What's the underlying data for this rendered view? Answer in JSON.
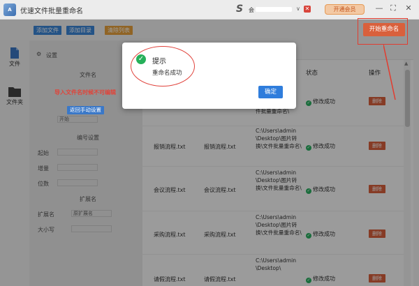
{
  "app": {
    "title": "优速文件批量重命名",
    "logo_text": "A",
    "brand_mark": "S",
    "account_prefix": "会",
    "caret": "∨",
    "vip_label": "开通会员"
  },
  "toolbar": {
    "add_file": "添加文件",
    "add_dir": "添加目录",
    "clear_list": "清除列表",
    "start_rename": "开始重命名"
  },
  "rail": {
    "items": [
      {
        "label": "文件",
        "icon": "document-icon"
      },
      {
        "label": "文件夹",
        "icon": "folder-icon"
      }
    ]
  },
  "settings": {
    "header": "设置",
    "section_filename": "文件名",
    "import_warning": "导入文件名时候不可编辑",
    "return_manual": "返回手动设置",
    "field_placeholder": "开始",
    "section_numbering": "编号设置",
    "section_extension": "扩展名",
    "ext_value": "原扩展名",
    "label_start": "起始",
    "label_step": "增量",
    "label_digits": "位数",
    "label_ext": "扩展名",
    "label_case": "大小写"
  },
  "table": {
    "headers": [
      "状态",
      "操作"
    ],
    "rows": [
      {
        "old": "",
        "new": "",
        "path": "件批量重命名\\",
        "status": "修改成功",
        "action": "删除"
      },
      {
        "old": "报销流程.txt",
        "new": "报销流程.txt",
        "path": "C:\\Users\\admin\\Desktop\\图片转换\\文件批量重命名\\",
        "status": "修改成功",
        "action": "删除"
      },
      {
        "old": "会议流程.txt",
        "new": "会议流程.txt",
        "path": "C:\\Users\\admin\\Desktop\\图片转换\\文件批量重命名\\",
        "status": "修改成功",
        "action": "删除"
      },
      {
        "old": "采购流程.txt",
        "new": "采购流程.txt",
        "path": "C:\\Users\\admin\\Desktop\\图片转换\\文件批量重命名\\",
        "status": "修改成功",
        "action": "删除"
      },
      {
        "old": "请假流程.txt",
        "new": "请假流程.txt",
        "path": "C:\\Users\\admin\\Desktop\\",
        "status": "修改成功",
        "action": "删除"
      }
    ]
  },
  "dialog": {
    "title": "提示",
    "message": "重命名成功",
    "ok": "确定"
  },
  "colors": {
    "accent_blue": "#2f7ddc",
    "accent_orange": "#d9603c",
    "success_green": "#26b05a",
    "annotation_red": "#e0413a"
  }
}
